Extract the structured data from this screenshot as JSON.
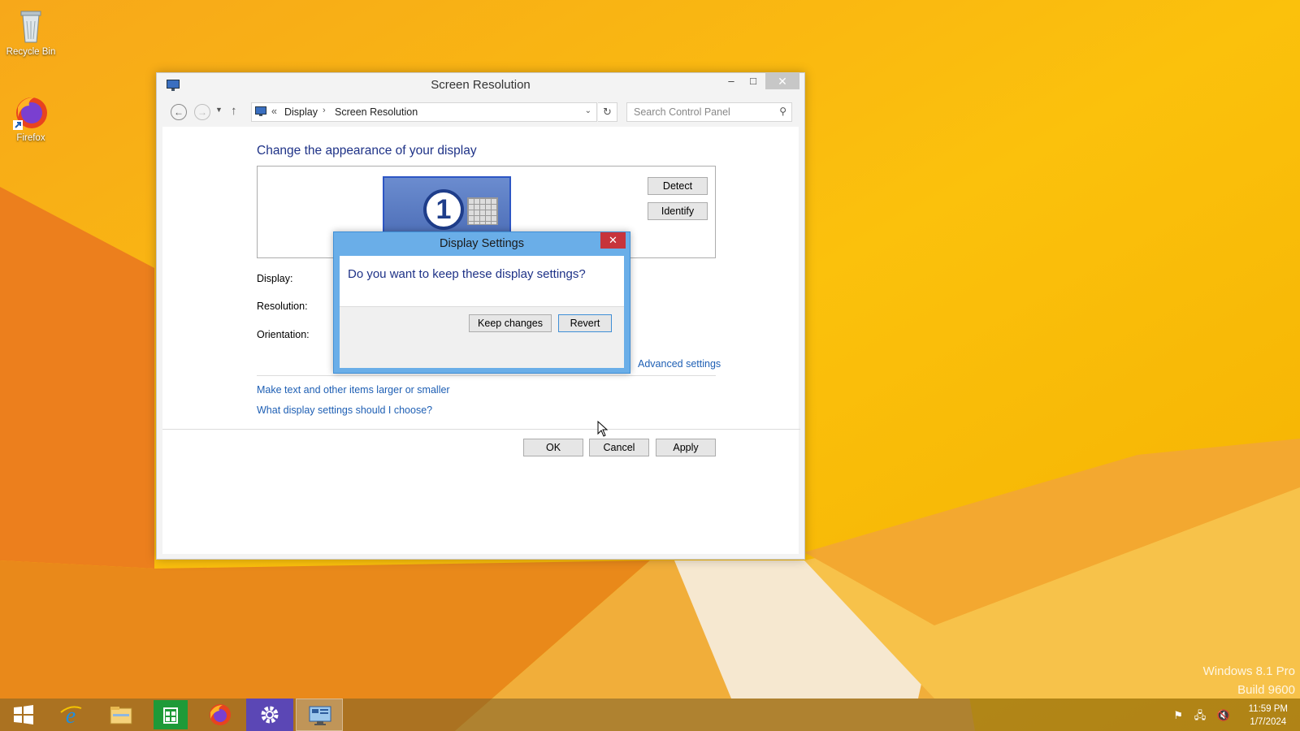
{
  "desktop": {
    "icons": [
      {
        "label": "Recycle Bin",
        "icon": "recycle-bin-icon"
      },
      {
        "label": "Firefox",
        "icon": "firefox-icon"
      }
    ],
    "watermark": {
      "line1": "Windows 8.1 Pro",
      "line2": "Build 9600"
    }
  },
  "window": {
    "title": "Screen Resolution",
    "controls": {
      "minimize": "–",
      "maximize": "□",
      "close": "✕"
    },
    "address": {
      "chevron": "«",
      "crumbs": [
        "Display",
        "Screen Resolution"
      ],
      "separator": "›"
    },
    "search": {
      "placeholder": "Search Control Panel"
    },
    "heading": "Change the appearance of your display",
    "monitor": {
      "number": "1"
    },
    "buttons": {
      "detect": "Detect",
      "identify": "Identify",
      "ok": "OK",
      "cancel": "Cancel",
      "apply": "Apply"
    },
    "fields": {
      "display": "Display:",
      "resolution": "Resolution:",
      "orientation": "Orientation:"
    },
    "links": {
      "advanced": "Advanced settings",
      "text_size": "Make text and other items larger or smaller",
      "which_settings": "What display settings should I choose?"
    }
  },
  "dialog": {
    "title": "Display Settings",
    "close": "✕",
    "question": "Do you want to keep these display settings?",
    "keep_label": "Keep changes",
    "revert_label": "Revert"
  },
  "taskbar": {
    "items": [
      {
        "name": "start",
        "icon": "windows-logo-icon"
      },
      {
        "name": "internet-explorer",
        "icon": "internet-explorer-icon"
      },
      {
        "name": "file-explorer",
        "icon": "folder-icon"
      },
      {
        "name": "store",
        "icon": "store-icon"
      },
      {
        "name": "firefox",
        "icon": "firefox-icon"
      },
      {
        "name": "settings",
        "icon": "gear-icon"
      },
      {
        "name": "control-panel",
        "icon": "control-panel-icon"
      }
    ],
    "clock": {
      "time": "11:59 PM",
      "date": "1/7/2024"
    }
  },
  "colors": {
    "accent": "#1e3287",
    "link": "#1e5fb4",
    "dialog_frame": "#6aaee8",
    "close_red": "#c7343b"
  }
}
